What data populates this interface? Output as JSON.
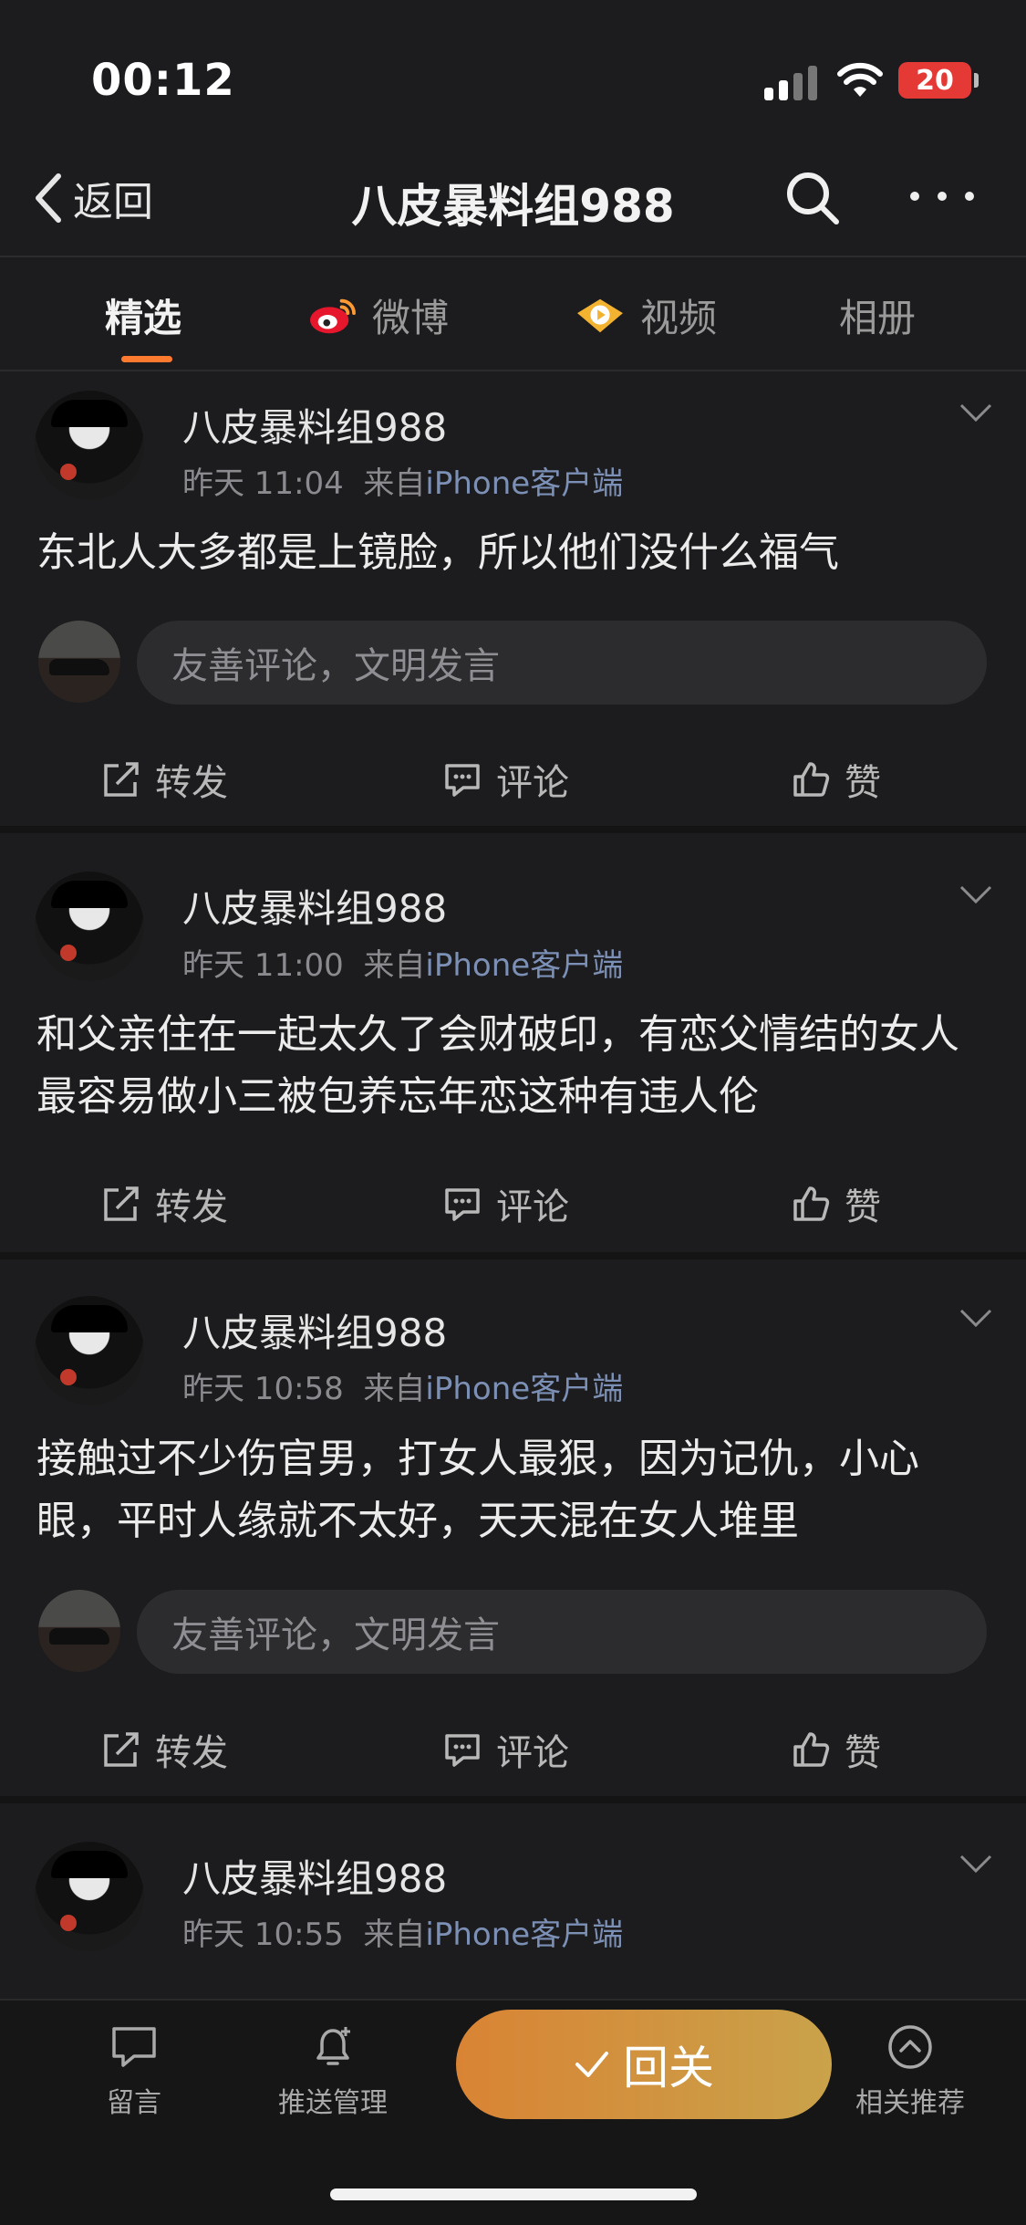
{
  "status_bar": {
    "time": "00:12",
    "battery": "20"
  },
  "header": {
    "back_label": "返回",
    "title": "八皮暴料组988"
  },
  "tabs": [
    {
      "label": "精选"
    },
    {
      "label": "微博"
    },
    {
      "label": "视频"
    },
    {
      "label": "相册"
    }
  ],
  "comment_placeholder": "友善评论，文明发言",
  "actions": {
    "repost": "转发",
    "comment": "评论",
    "like": "赞"
  },
  "posts": [
    {
      "username": "八皮暴料组988",
      "time": "昨天 11:04",
      "from": "来自",
      "source": "iPhone客户端",
      "text": "东北人大多都是上镜脸，所以他们没什么福气"
    },
    {
      "username": "八皮暴料组988",
      "time": "昨天 11:00",
      "from": "来自",
      "source": "iPhone客户端",
      "text": "和父亲住在一起太久了会财破印，有恋父情结的女人最容易做小三被包养忘年恋这种有违人伦"
    },
    {
      "username": "八皮暴料组988",
      "time": "昨天 10:58",
      "from": "来自",
      "source": "iPhone客户端",
      "text": "接触过不少伤官男，打女人最狠，因为记仇，小心眼，平时人缘就不太好，天天混在女人堆里"
    },
    {
      "username": "八皮暴料组988",
      "time": "昨天 10:55",
      "from": "来自",
      "source": "iPhone客户端",
      "text": ""
    }
  ],
  "bottom_nav": {
    "message": "留言",
    "push": "推送管理",
    "follow": "回关",
    "related": "相关推荐"
  }
}
